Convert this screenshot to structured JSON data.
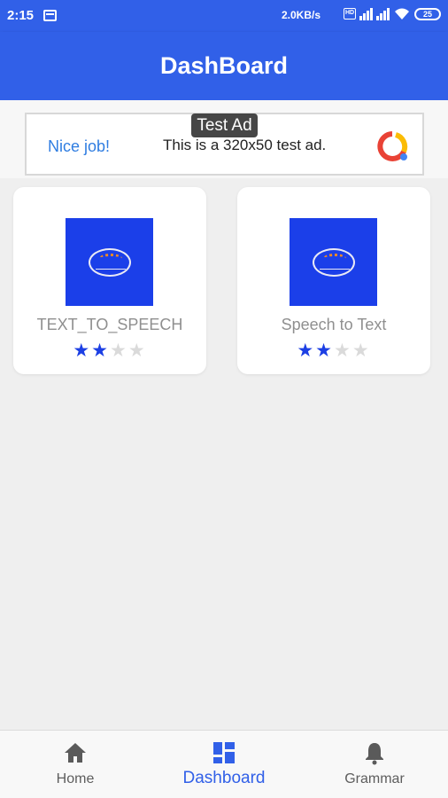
{
  "status_bar": {
    "time": "2:15",
    "speed": "2.0KB/s",
    "hd_label": "HD",
    "battery": "25",
    "icons": [
      "calendar-icon",
      "hd-icon",
      "signal-icon",
      "signal-icon",
      "wifi-icon",
      "battery-icon"
    ]
  },
  "app_bar": {
    "title": "DashBoard",
    "color": "#3160e8"
  },
  "ad": {
    "badge": "Test Ad",
    "cta": "Nice job!",
    "text": "This is a 320x50 test ad."
  },
  "cards": [
    {
      "title": "TEXT_TO_SPEECH",
      "rating": 2,
      "max_rating": 5
    },
    {
      "title": "Speech to Text",
      "rating": 2,
      "max_rating": 5
    }
  ],
  "bottom_nav": {
    "items": [
      {
        "label": "Home",
        "icon": "home-icon",
        "active": false
      },
      {
        "label": "Dashboard",
        "icon": "dashboard-icon",
        "active": true
      },
      {
        "label": "Grammar",
        "icon": "bell-icon",
        "active": false
      }
    ]
  }
}
